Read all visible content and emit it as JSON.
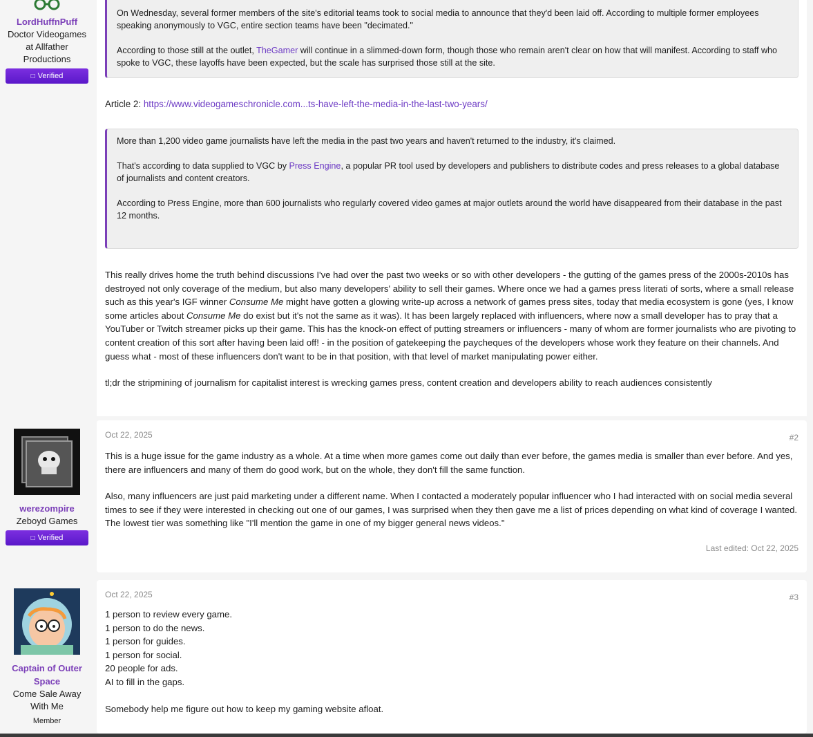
{
  "post1": {
    "user": {
      "name": "LordHuffnPuff",
      "title": "Doctor Videogames at Allfather Productions",
      "badge": "Verified",
      "badge_icon": "check-icon"
    },
    "quote1": {
      "para1": "On Wednesday, several former members of the site's editorial teams took to social media to announce that they'd been laid off. According to multiple former employees speaking anonymously to VGC, entire section teams have been \"decimated.\"",
      "para2_before": "According to those still at the outlet, ",
      "para2_link": "TheGamer",
      "para2_after": " will continue in a slimmed-down form, though those who remain aren't clear on how that will manifest. According to staff who spoke to VGC, these layoffs have been expected, but the scale has surprised those still at the site."
    },
    "article2_label": "Article 2: ",
    "article2_link": "https://www.videogameschronicle.com...ts-have-left-the-media-in-the-last-two-years/",
    "quote2": {
      "para1": "More than 1,200 video game journalists have left the media in the past two years and haven't returned to the industry, it's claimed.",
      "para2_before": "That's according to data supplied to VGC by ",
      "para2_link": "Press Engine",
      "para2_after": ", a popular PR tool used by developers and publishers to distribute codes and press releases to a global database of journalists and content creators.",
      "para3": "According to Press Engine, more than 600 journalists who regularly covered video games at major outlets around the world have disappeared from their database in the past 12 months."
    },
    "body": {
      "p1_a": "This really drives home the truth behind discussions I've had over the past two weeks or so with other developers - the gutting of the games press of the 2000s-2010s has destroyed not only coverage of the medium, but also many developers' ability to sell their games. Where once we had a games press literati of sorts, where a small release such as this year's IGF winner ",
      "p1_em1": "Consume Me",
      "p1_b": " might have gotten a glowing write-up across a network of games press sites, today that media ecosystem is gone (yes, I know some articles about ",
      "p1_em2": "Consume Me",
      "p1_c": " do exist but it's not the same as it was). It has been largely replaced with influencers, where now a small developer has to pray that a YouTuber or Twitch streamer picks up their game. This has the knock-on effect of putting streamers or influencers - many of whom are former journalists who are pivoting to content creation of this sort after having been laid off! - in the position of gatekeeping the paycheques of the developers whose work they feature on their channels. And guess what - most of these influencers don't want to be in that position, with that level of market manipulating power either.",
      "p2": "tl;dr the stripmining of journalism for capitalist interest is wrecking games press, content creation and developers ability to reach audiences consistently"
    }
  },
  "post2": {
    "user": {
      "name": "werezompire",
      "title": "Zeboyd Games",
      "badge": "Verified",
      "badge_icon": "check-icon"
    },
    "date": "Oct 22, 2025",
    "number": "#2",
    "p1": "This is a huge issue for the game industry as a whole. At a time when more games come out daily than ever before, the games media is smaller than ever before. And yes, there are influencers and many of them do good work, but on the whole, they don't fill the same function.",
    "p2": "Also, many influencers are just paid marketing under a different name. When I contacted a moderately popular influencer who I had interacted with on social media several times to see if they were interested in checking out one of our games, I was surprised when they then gave me a list of prices depending on what kind of coverage I wanted. The lowest tier was something like \"I'll mention the game in one of my bigger general news videos.\"",
    "edited": "Last edited: Oct 22, 2025"
  },
  "post3": {
    "user": {
      "name": "Captain of Outer Space",
      "title": "Come Sale Away With Me",
      "role": "Member"
    },
    "date": "Oct 22, 2025",
    "number": "#3",
    "lines": [
      "1 person to review every game.",
      "1 person to do the news.",
      "1 person for guides.",
      "1 person for social.",
      "20 people for ads.",
      "AI to fill in the gaps."
    ],
    "p2": "Somebody help me figure out how to keep my gaming website afloat."
  },
  "colors": {
    "accent": "#7b3fb8",
    "badge": "#6a22d6",
    "quote_bg": "#efefef"
  }
}
